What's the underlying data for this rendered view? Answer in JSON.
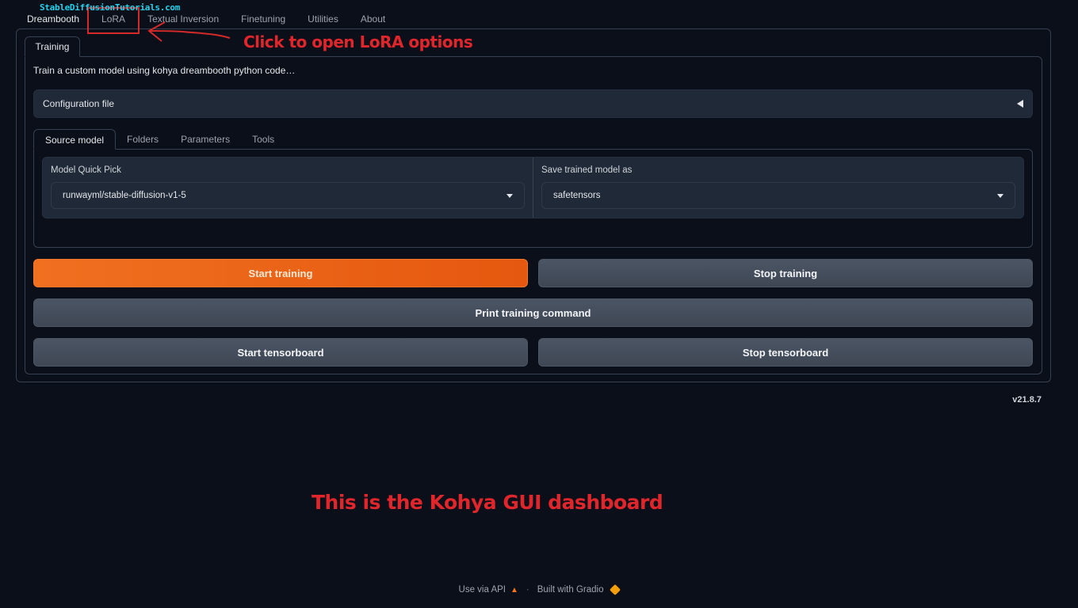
{
  "watermark": "StableDiffusionTutorials.com",
  "top_tabs": [
    {
      "label": "Dreambooth",
      "active": true
    },
    {
      "label": "LoRA",
      "active": false
    },
    {
      "label": "Textual Inversion",
      "active": false
    },
    {
      "label": "Finetuning",
      "active": false
    },
    {
      "label": "Utilities",
      "active": false
    },
    {
      "label": "About",
      "active": false
    }
  ],
  "inner_tab": "Training",
  "description": "Train a custom model using kohya dreambooth python code…",
  "config_accordion": {
    "label": "Configuration file",
    "icon": "triangle-left-icon"
  },
  "sub_tabs": [
    {
      "label": "Source model",
      "active": true
    },
    {
      "label": "Folders",
      "active": false
    },
    {
      "label": "Parameters",
      "active": false
    },
    {
      "label": "Tools",
      "active": false
    }
  ],
  "form": {
    "model_quick_pick": {
      "label": "Model Quick Pick",
      "value": "runwayml/stable-diffusion-v1-5"
    },
    "save_as": {
      "label": "Save trained model as",
      "value": "safetensors"
    }
  },
  "buttons": {
    "start_training": "Start training",
    "stop_training": "Stop training",
    "print_command": "Print training command",
    "start_tensorboard": "Start tensorboard",
    "stop_tensorboard": "Stop tensorboard"
  },
  "version": "v21.8.7",
  "annotations": {
    "lora_hint": "Click to open LoRA options",
    "dashboard_note": "This is the Kohya GUI dashboard",
    "color": "#e0262b"
  },
  "footer": {
    "api": "Use via API",
    "separator": "·",
    "built_with": "Built with Gradio"
  },
  "colors": {
    "background": "#0b0f19",
    "panel": "#1f2937",
    "primary_button": "#f07020",
    "secondary_button": "#4b5563"
  }
}
